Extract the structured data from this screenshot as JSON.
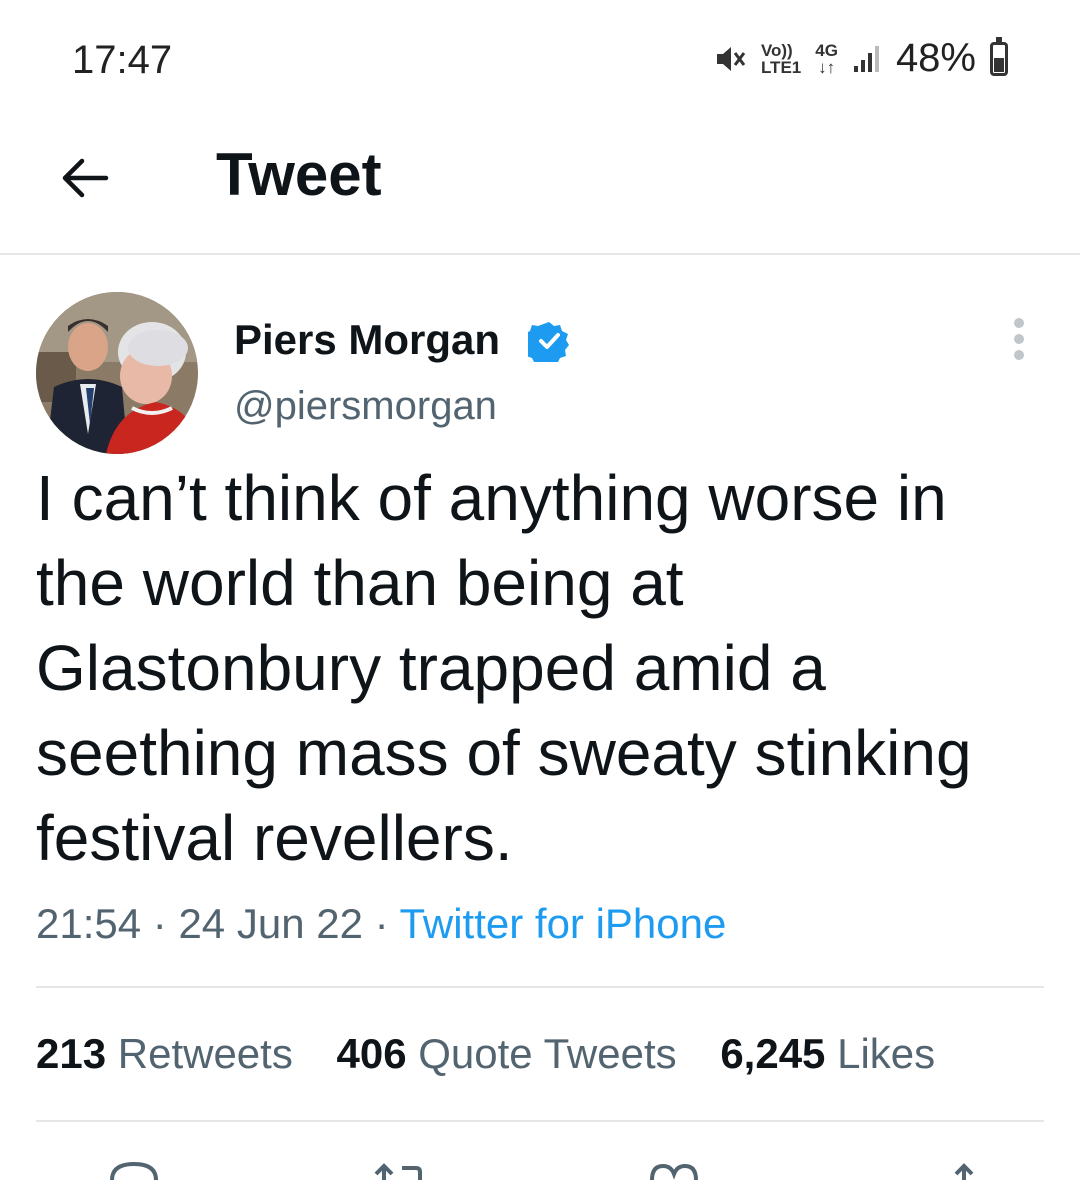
{
  "status_bar": {
    "time": "17:47",
    "volte_top": "Vo))",
    "volte_bottom": "LTE1",
    "network_type": "4G",
    "network_arrows": "↓↑",
    "battery_percent": "48%",
    "battery_level": 0.48
  },
  "header": {
    "back_icon": "arrow-left-icon",
    "title": "Tweet"
  },
  "tweet": {
    "author": {
      "name": "Piers Morgan",
      "handle": "@piersmorgan",
      "verified": true,
      "verified_color": "#1d9bf0"
    },
    "text": "I can’t think of anything worse in the world than being at Glastonbury trapped amid a seething mass of sweaty stinking festival revellers.",
    "time": "21:54",
    "date": "24 Jun 22",
    "separator": "·",
    "source": "Twitter for iPhone",
    "stats": {
      "retweets_count": "213",
      "retweets_label": "Retweets",
      "quotes_count": "406",
      "quotes_label": "Quote Tweets",
      "likes_count": "6,245",
      "likes_label": "Likes"
    },
    "actions": [
      "reply-icon",
      "retweet-icon",
      "like-icon",
      "share-icon"
    ]
  },
  "colors": {
    "accent": "#1d9bf0",
    "text_primary": "#0f1419",
    "text_secondary": "#536471",
    "divider": "#e6e6e6"
  }
}
